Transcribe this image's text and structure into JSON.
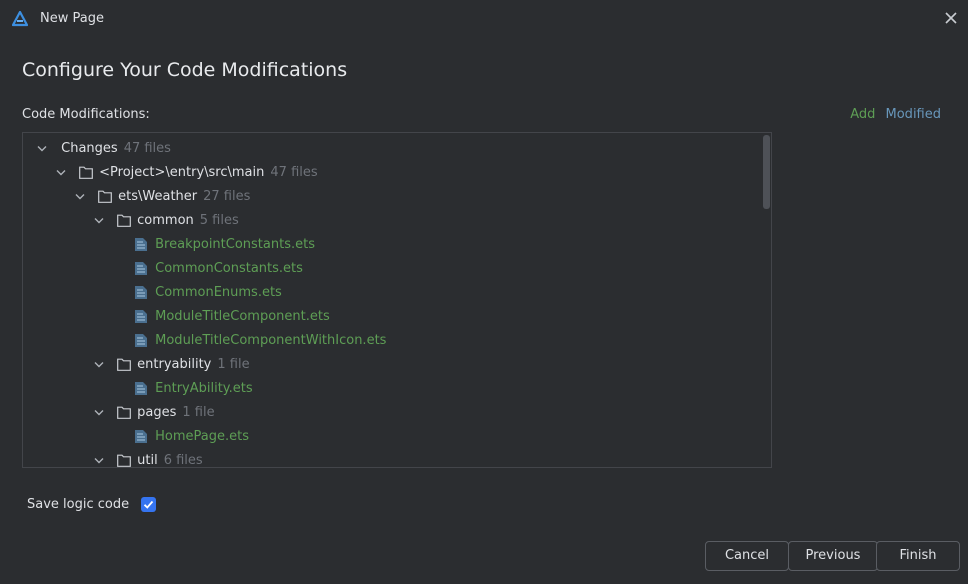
{
  "window": {
    "title": "New Page"
  },
  "heading": "Configure Your Code Modifications",
  "section_label": "Code Modifications:",
  "legend": {
    "add": "Add",
    "modified": "Modified"
  },
  "tree": [
    {
      "name": "Changes",
      "count": "47 files",
      "type": "group"
    },
    {
      "name": "<Project>\\entry\\src\\main",
      "count": "47 files",
      "type": "folder"
    },
    {
      "name": "ets\\Weather",
      "count": "27 files",
      "type": "folder"
    },
    {
      "name": "common",
      "count": "5 files",
      "type": "folder"
    },
    {
      "name": "BreakpointConstants.ets",
      "type": "file"
    },
    {
      "name": "CommonConstants.ets",
      "type": "file"
    },
    {
      "name": "CommonEnums.ets",
      "type": "file"
    },
    {
      "name": "ModuleTitleComponent.ets",
      "type": "file"
    },
    {
      "name": "ModuleTitleComponentWithIcon.ets",
      "type": "file"
    },
    {
      "name": "entryability",
      "count": "1 file",
      "type": "folder"
    },
    {
      "name": "EntryAbility.ets",
      "type": "file"
    },
    {
      "name": "pages",
      "count": "1 file",
      "type": "folder"
    },
    {
      "name": "HomePage.ets",
      "type": "file"
    },
    {
      "name": "util",
      "count": "6 files",
      "type": "folder"
    }
  ],
  "save_logic": {
    "label": "Save logic code",
    "checked": true
  },
  "buttons": {
    "cancel": "Cancel",
    "previous": "Previous",
    "finish": "Finish"
  },
  "colors": {
    "added": "#5e9e55",
    "modified": "#6897bb",
    "accent": "#3574f0",
    "background": "#2b2d30"
  }
}
